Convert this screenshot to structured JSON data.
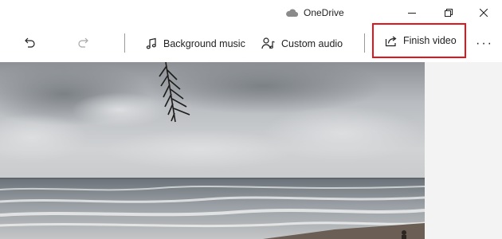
{
  "titlebar": {
    "account_label": "OneDrive",
    "account_icon": "cloud-icon",
    "window_controls": [
      "minimize-icon",
      "maximize-icon",
      "close-icon"
    ]
  },
  "toolbar": {
    "undo_icon": "undo-icon",
    "redo_icon": "redo-icon",
    "background_music_label": "Background music",
    "background_music_icon": "music-note-icon",
    "custom_audio_label": "Custom audio",
    "custom_audio_icon": "person-audio-icon",
    "finish_video_label": "Finish video",
    "finish_video_icon": "share-icon",
    "more_label": "···",
    "highlight_color": "#e3141b"
  },
  "preview": {
    "description_icon": "video-preview"
  }
}
